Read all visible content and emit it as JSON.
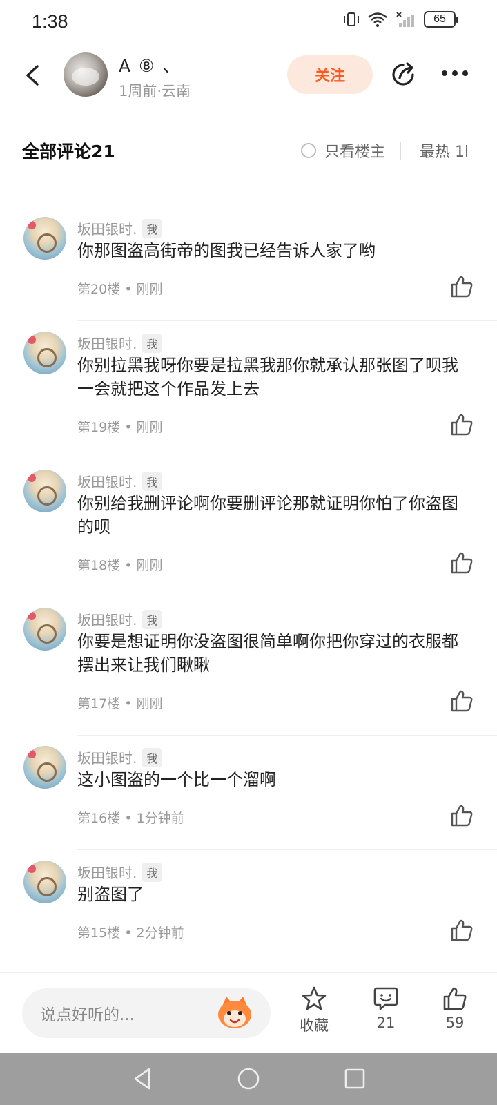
{
  "status_bar": {
    "time": "1:38",
    "battery": "65"
  },
  "header": {
    "user_name": "A ⑧ 、",
    "user_meta": "1周前·云南",
    "follow_label": "关注"
  },
  "comments_header": {
    "title": "全部评论21",
    "op_only_label": "只看楼主",
    "sort_label": "最热 1l"
  },
  "comments": [
    {
      "author": "坂田银时.",
      "badge": "我",
      "text": "你那图盗高街帝的图我已经告诉人家了哟",
      "floor": "第20楼",
      "time": "刚刚"
    },
    {
      "author": "坂田银时.",
      "badge": "我",
      "text": "你别拉黑我呀你要是拉黑我那你就承认那张图了呗我一会就把这个作品发上去",
      "floor": "第19楼",
      "time": "刚刚"
    },
    {
      "author": "坂田银时.",
      "badge": "我",
      "text": "你别给我删评论啊你要删评论那就证明你怕了你盗图的呗",
      "floor": "第18楼",
      "time": "刚刚"
    },
    {
      "author": "坂田银时.",
      "badge": "我",
      "text": "你要是想证明你没盗图很简单啊你把你穿过的衣服都摆出来让我们瞅瞅",
      "floor": "第17楼",
      "time": "刚刚"
    },
    {
      "author": "坂田银时.",
      "badge": "我",
      "text": "这小图盗的一个比一个溜啊",
      "floor": "第16楼",
      "time": "1分钟前"
    },
    {
      "author": "坂田银时.",
      "badge": "我",
      "text": "别盗图了",
      "floor": "第15楼",
      "time": "2分钟前"
    }
  ],
  "meta_separator": " • ",
  "bottom_bar": {
    "input_placeholder": "说点好听的...",
    "favorite_label": "收藏",
    "comment_count": "21",
    "like_count": "59"
  },
  "icons": {
    "back": "back-arrow-icon",
    "share": "share-icon",
    "more": "more-icon",
    "like": "thumbs-up-icon",
    "star": "star-icon",
    "comment": "comment-bubble-icon",
    "emoji": "emoji-mascot-icon"
  },
  "colors": {
    "accent": "#ff5a1f",
    "follow_bg": "#fde8de"
  }
}
